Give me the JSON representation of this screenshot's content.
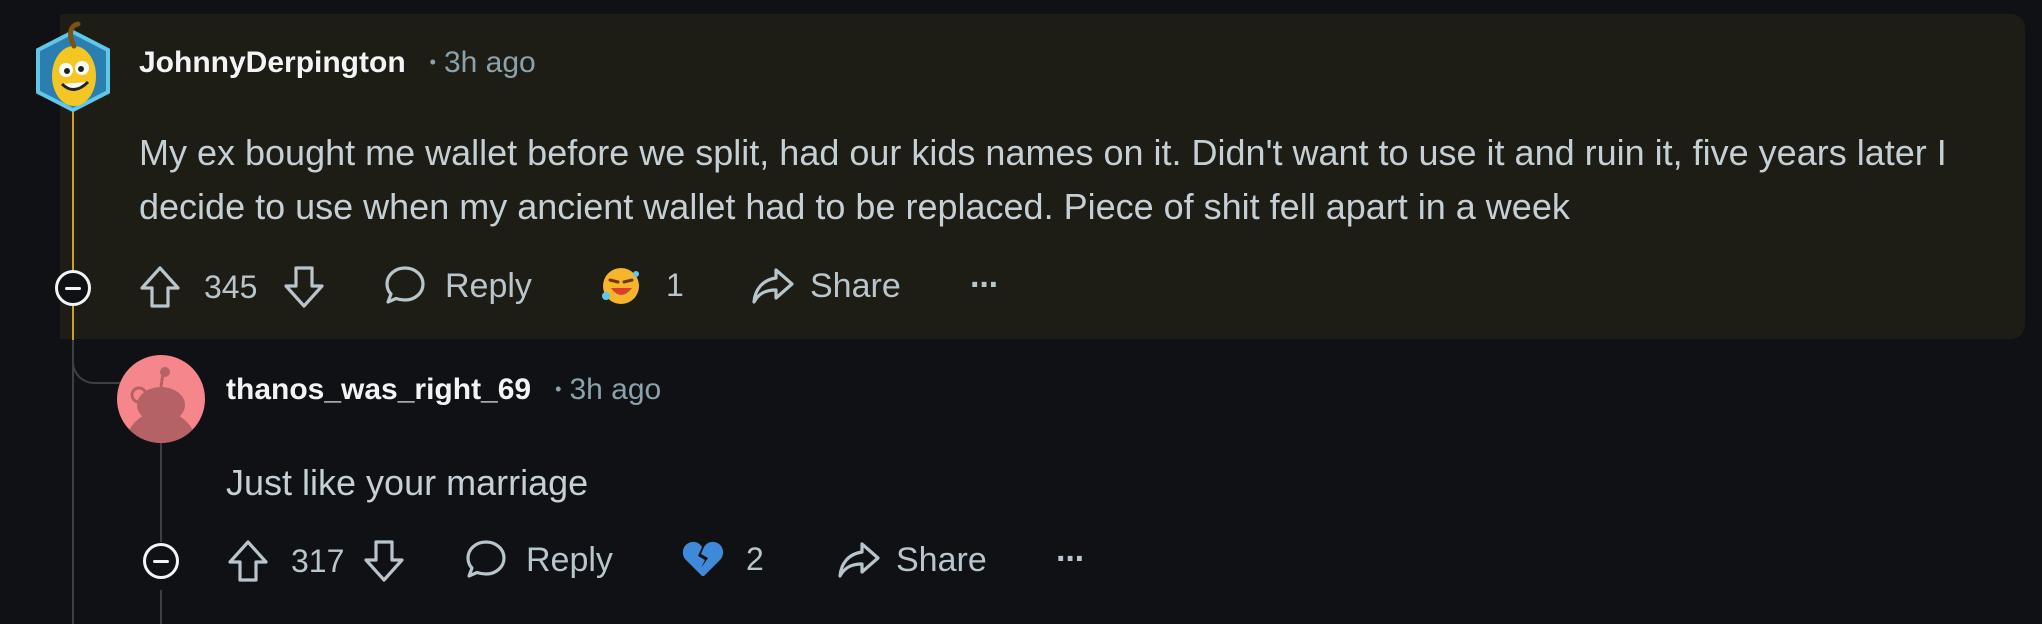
{
  "comments": [
    {
      "username": "JohnnyDerpington",
      "time": "3h ago",
      "separator": "•",
      "body": "My ex bought me wallet before we split, had our kids names on it. Didn't want to use it and ruin it, five years later I decide to use when my ancient wallet had to be replaced. Piece of shit fell apart in a week",
      "votes": "345",
      "reply_label": "Reply",
      "award_count": "1",
      "award_icon": "laughing-emoji-icon",
      "share_label": "Share",
      "more_label": "···",
      "highlighted": true
    },
    {
      "username": "thanos_was_right_69",
      "time": "3h ago",
      "separator": "•",
      "body": "Just like your marriage",
      "votes": "317",
      "reply_label": "Reply",
      "award_count": "2",
      "award_icon": "broken-heart-icon",
      "share_label": "Share",
      "more_label": "···",
      "highlighted": false
    }
  ],
  "colors": {
    "background": "#0f1114",
    "highlight": "#1e1d15",
    "thread_line_active": "#d49a2a",
    "thread_line": "#3a4045",
    "text_primary": "#f2f4f5",
    "text_secondary": "#8ba2ad"
  }
}
